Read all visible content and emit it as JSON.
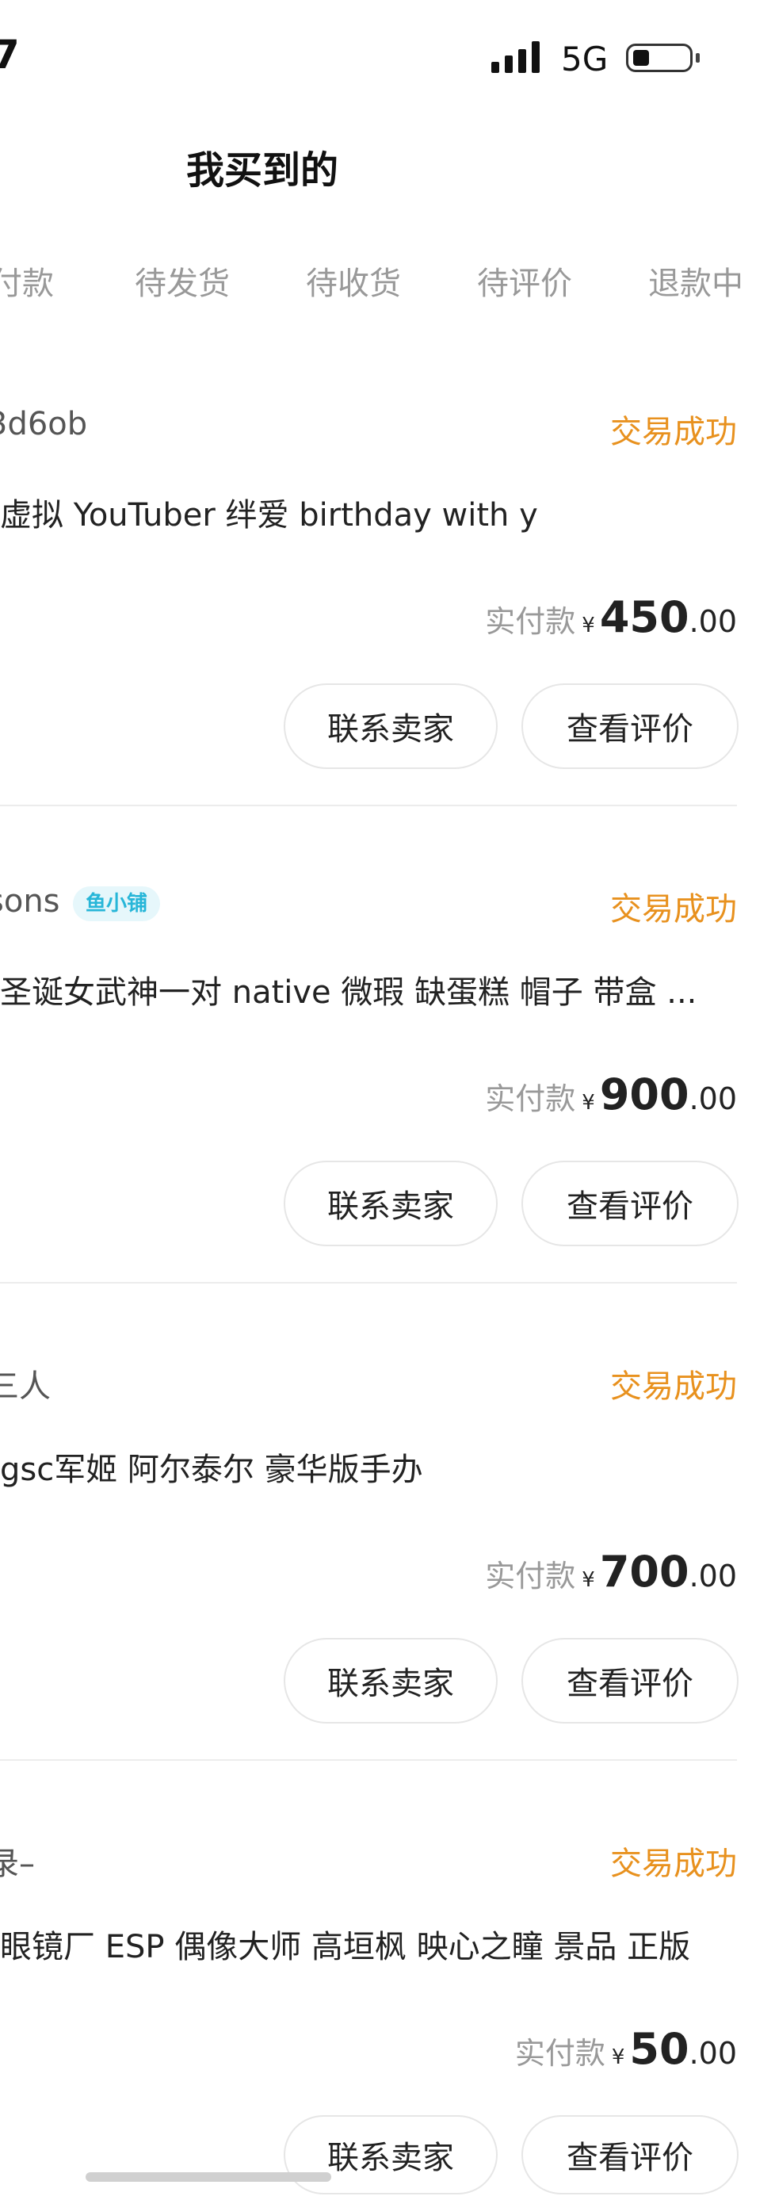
{
  "status_bar": {
    "time_fragment": "7",
    "network": "5G"
  },
  "header": {
    "title": "我买到的"
  },
  "tabs": [
    "付款",
    "待发货",
    "待收货",
    "待评价",
    "退款中"
  ],
  "orders": [
    {
      "shop": "3d6ob",
      "badge": "",
      "status": "交易成功",
      "title": "虚拟 YouTuber 绊爱 birthday with y",
      "paid_label": "实付款",
      "currency": "¥",
      "price_int": "450",
      "price_dec": ".00",
      "contact_label": "联系卖家",
      "review_label": "查看评价"
    },
    {
      "shop": "sons",
      "badge": "鱼小铺",
      "status": "交易成功",
      "title": "圣诞女武神一对 native 微瑕 缺蛋糕 帽子 带盒 ...",
      "paid_label": "实付款",
      "currency": "¥",
      "price_int": "900",
      "price_dec": ".00",
      "contact_label": "联系卖家",
      "review_label": "查看评价"
    },
    {
      "shop": "三人",
      "badge": "",
      "status": "交易成功",
      "title": "gsc军姬 阿尔泰尔 豪华版手办",
      "paid_label": "实付款",
      "currency": "¥",
      "price_int": "700",
      "price_dec": ".00",
      "contact_label": "联系卖家",
      "review_label": "查看评价"
    },
    {
      "shop": "录–",
      "badge": "",
      "status": "交易成功",
      "title": "眼镜厂 ESP 偶像大师 高垣枫 映心之瞳 景品 正版",
      "paid_label": "实付款",
      "currency": "¥",
      "price_int": "50",
      "price_dec": ".00",
      "contact_label": "联系卖家",
      "review_label": "查看评价"
    }
  ]
}
